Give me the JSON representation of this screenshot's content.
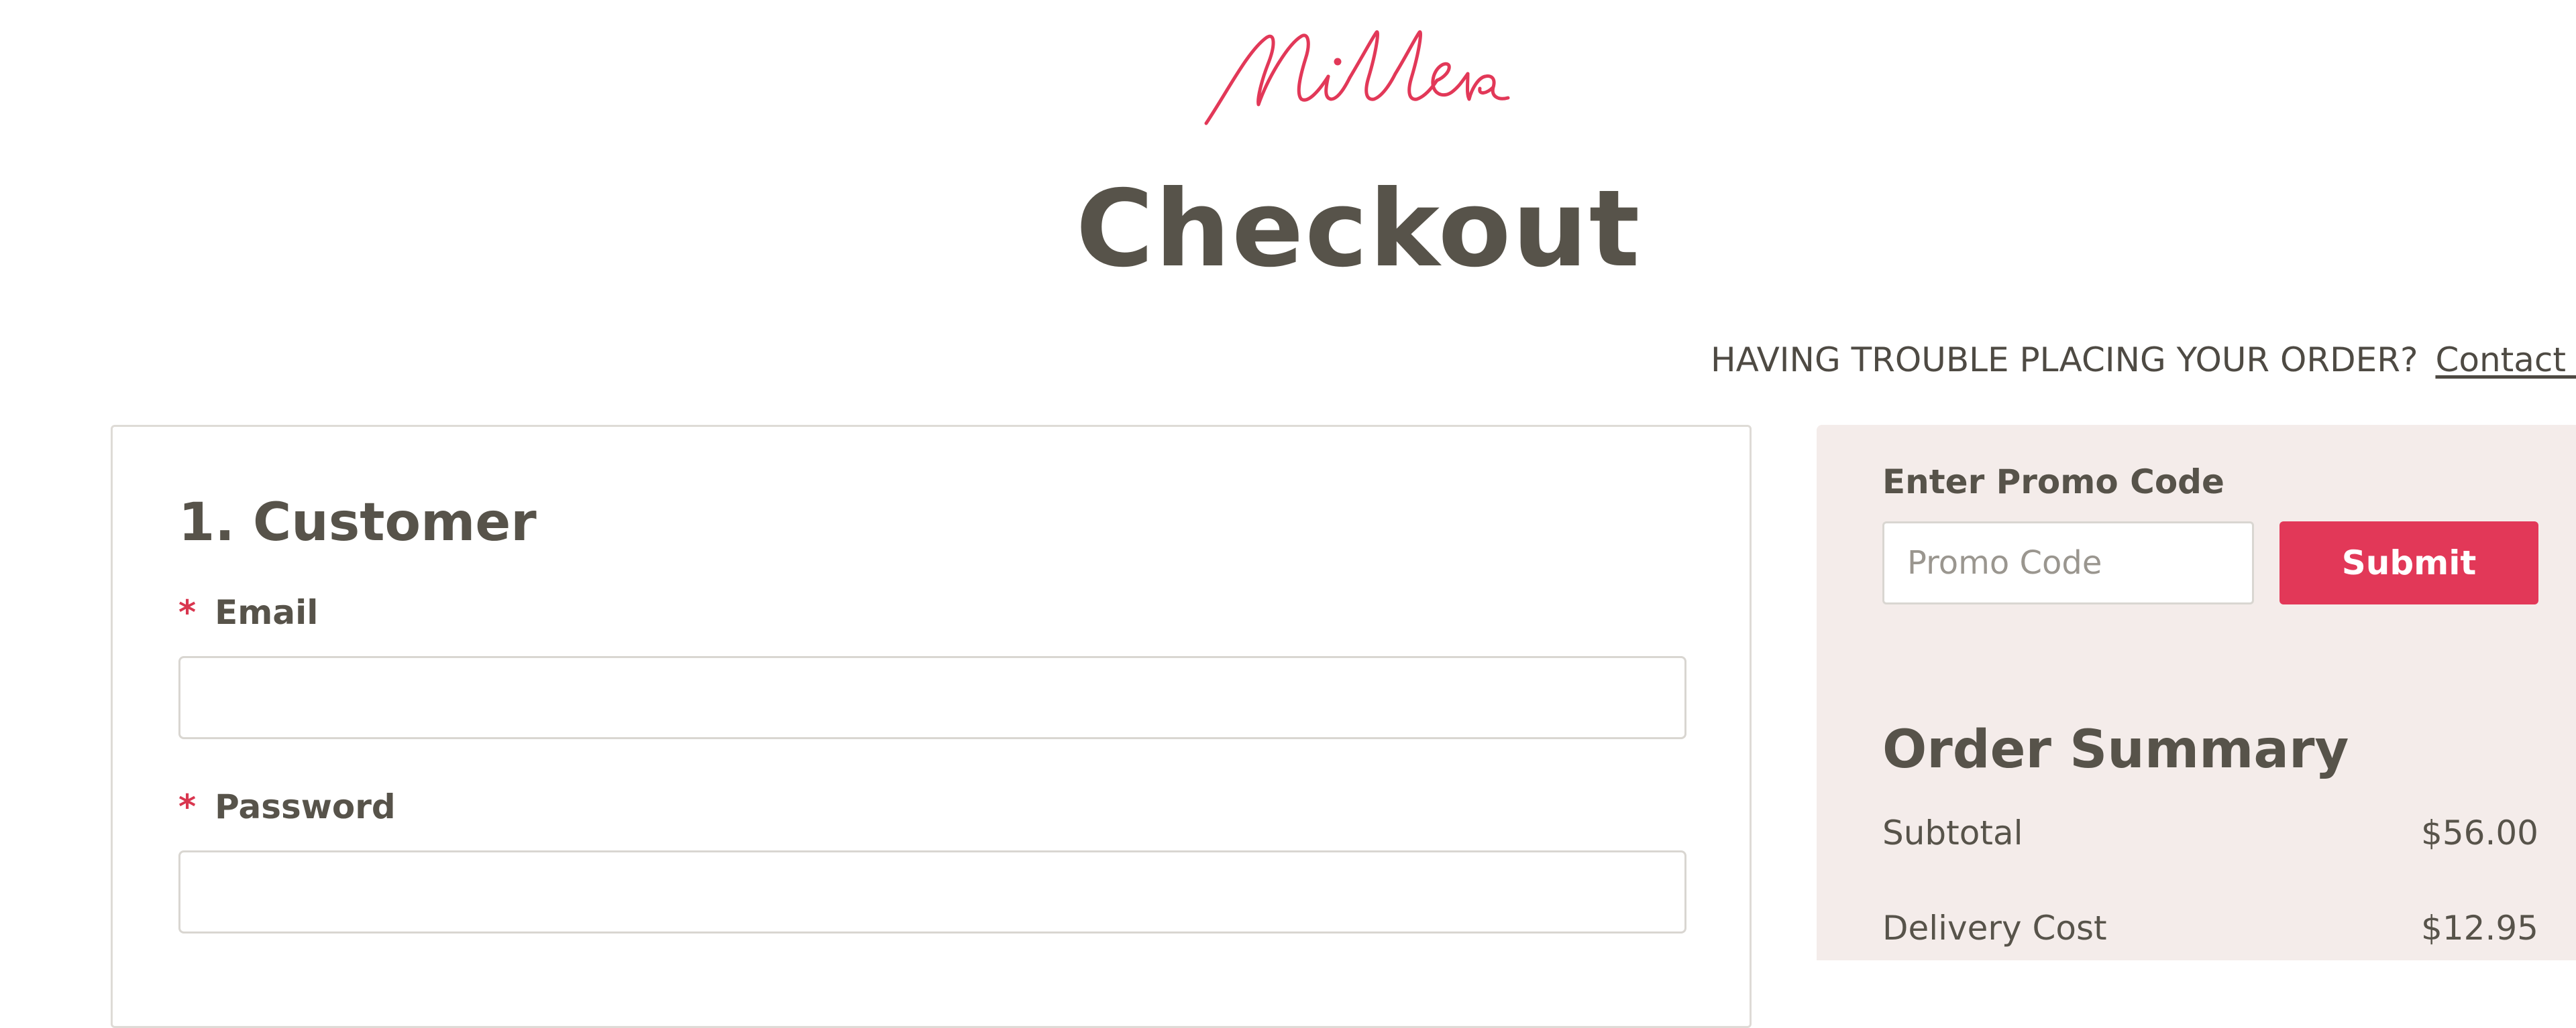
{
  "header": {
    "brand": "Millers",
    "title": "Checkout"
  },
  "help": {
    "text": "HAVING TROUBLE PLACING YOUR ORDER?",
    "link_label": "Contact Us"
  },
  "customer": {
    "section_title": "1. Customer",
    "required_marker": "*",
    "email_label": "Email",
    "email_value": "",
    "password_label": "Password",
    "password_value": ""
  },
  "promo": {
    "label": "Enter Promo Code",
    "placeholder": "Promo Code",
    "submit_label": "Submit"
  },
  "order_summary": {
    "title": "Order Summary",
    "rows": [
      {
        "label": "Subtotal",
        "value": "$56.00"
      },
      {
        "label": "Delivery Cost",
        "value": "$12.95"
      }
    ]
  },
  "colors": {
    "accent": "#e23858",
    "text": "#57534a",
    "sidebar_bg": "#f4ecea",
    "required": "#d9364f"
  }
}
